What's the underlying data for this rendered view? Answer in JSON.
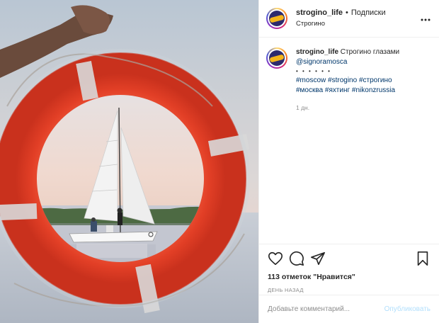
{
  "header": {
    "username": "strogino_life",
    "separator": "•",
    "follow_label": "Подписки",
    "location": "Строгино",
    "more_icon": "more-horizontal-icon"
  },
  "caption": {
    "username": "strogino_life",
    "text": "Строгино глазами",
    "mention": "@signoramosca",
    "dots": "• • • • • •",
    "hashtags_line1": [
      "#moscow",
      "#strogino",
      "#строгино"
    ],
    "hashtags_line2": [
      "#москва",
      "#яхтинг",
      "#nikonzrussia"
    ],
    "time_ago": "1 дн."
  },
  "actions": {
    "like_icon": "heart-icon",
    "comment_icon": "comment-icon",
    "share_icon": "share-icon",
    "save_icon": "bookmark-icon",
    "likes_text": "113 отметок \"Нравится\"",
    "post_date": "ДЕНЬ НАЗАД"
  },
  "comment": {
    "placeholder": "Добавьте комментарий...",
    "publish_label": "Опубликовать"
  },
  "colors": {
    "link": "#00376b",
    "muted": "#8e8e8e",
    "publish_disabled": "#b2dffc",
    "lifebuoy": "#e8452c"
  }
}
